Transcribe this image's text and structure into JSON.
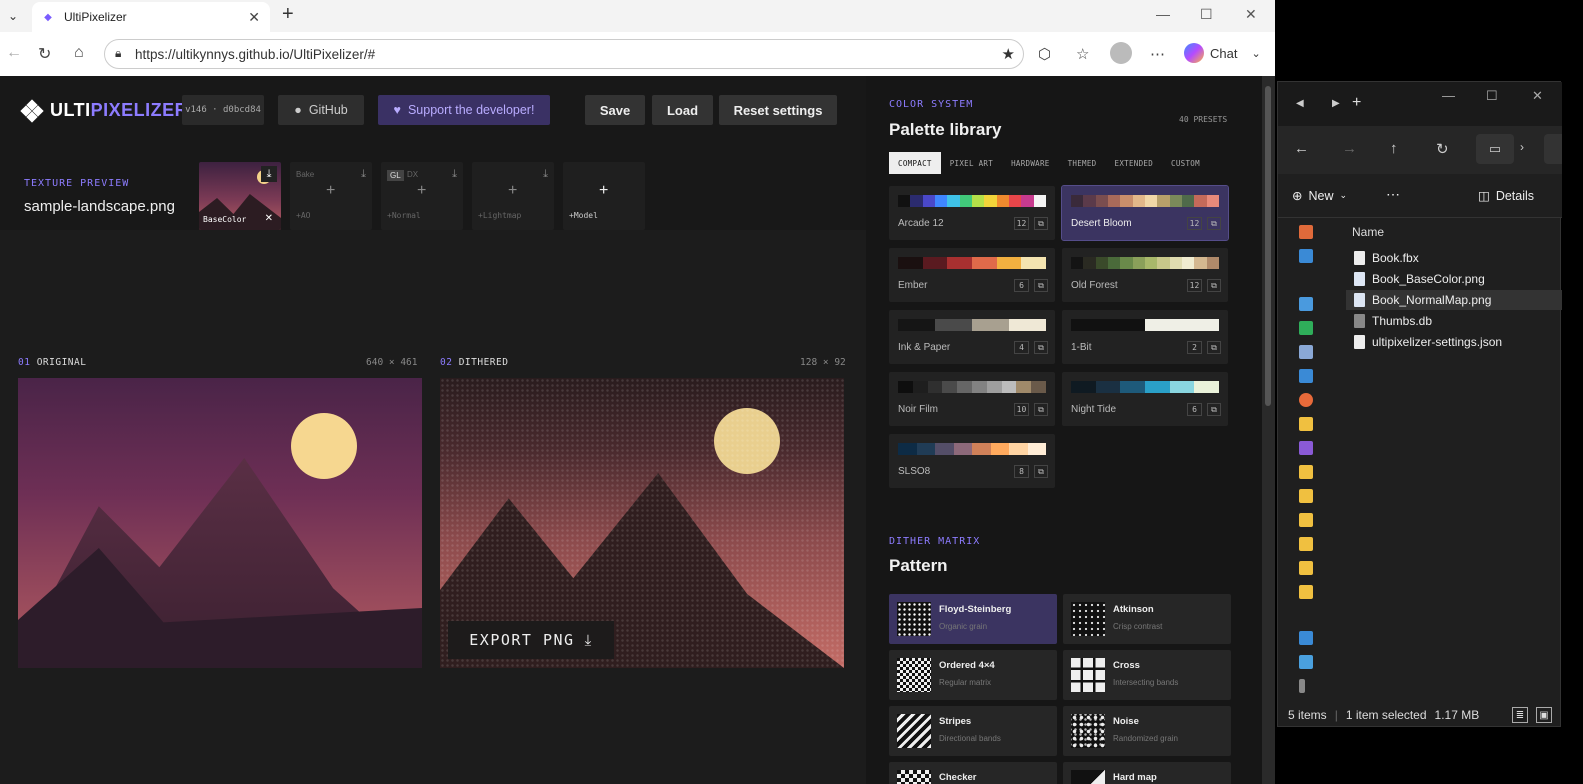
{
  "browser": {
    "tab_title": "UltiPixelizer",
    "url": "https://ultikynnys.github.io/UltiPixelizer/#",
    "chat_label": "Chat"
  },
  "app": {
    "logo_prefix": "ULTI",
    "logo_suffix": "PIXELIZER",
    "version": "v146 · d0bcd84",
    "github_label": "GitHub",
    "support_label": "Support the developer!",
    "save_label": "Save",
    "load_label": "Load",
    "reset_label": "Reset settings",
    "texture_preview_label": "TEXTURE PREVIEW",
    "texture_file": "sample-landscape.png",
    "slots": {
      "basecolor": "BaseColor",
      "bake": "Bake",
      "gl": "GL",
      "dx": "DX",
      "ao": "+AO",
      "normal": "+Normal",
      "lightmap": "+Lightmap",
      "model": "+Model"
    },
    "panels": {
      "original_num": "01",
      "original_label": "ORIGINAL",
      "original_dim": "640 × 461",
      "dithered_num": "02",
      "dithered_label": "DITHERED",
      "dithered_dim": "128 × 92"
    },
    "export_label": "EXPORT PNG"
  },
  "palette": {
    "section_label": "COLOR SYSTEM",
    "title": "Palette library",
    "preset_count": "40 PRESETS",
    "tabs": [
      "COMPACT",
      "PIXEL ART",
      "HARDWARE",
      "THEMED",
      "EXTENDED",
      "CUSTOM"
    ],
    "cards": [
      {
        "name": "Arcade 12",
        "count": "12",
        "colors": [
          "#111",
          "#2b2b6e",
          "#4a48c9",
          "#3f86ff",
          "#3fc2e8",
          "#41c97a",
          "#b4e049",
          "#f2d43a",
          "#f08a2e",
          "#e8464a",
          "#c73a8e",
          "#f4f4f4"
        ]
      },
      {
        "name": "Desert Bloom",
        "count": "12",
        "colors": [
          "#3a2a3a",
          "#5b3a4a",
          "#7a4d4f",
          "#a86a5a",
          "#c98e6b",
          "#e2b789",
          "#f1d7a7",
          "#b8a06a",
          "#7a8a5a",
          "#4f6a4a",
          "#c46a5a",
          "#e88a7a"
        ]
      },
      {
        "name": "Ember",
        "count": "6",
        "colors": [
          "#1a1010",
          "#5a1a20",
          "#a83030",
          "#e06a4a",
          "#f2b040",
          "#f4e4b0"
        ]
      },
      {
        "name": "Old Forest",
        "count": "12",
        "colors": [
          "#141414",
          "#2a2a22",
          "#3a4a2a",
          "#4a6a3a",
          "#6a8a4a",
          "#8aa05a",
          "#a8b86a",
          "#c8c88a",
          "#e0dcb0",
          "#f0ecd0",
          "#d4b890",
          "#b08a6a"
        ]
      },
      {
        "name": "Ink & Paper",
        "count": "4",
        "colors": [
          "#151515",
          "#4a4a4a",
          "#a8a090",
          "#efe8d6"
        ]
      },
      {
        "name": "1-Bit",
        "count": "2",
        "colors": [
          "#111111",
          "#efefe6"
        ]
      },
      {
        "name": "Noir Film",
        "count": "10",
        "colors": [
          "#0e0e0e",
          "#1e1e1e",
          "#2f2f2f",
          "#4a4a4a",
          "#666",
          "#828282",
          "#9e9e9e",
          "#bcbcbc",
          "#a08a6a",
          "#6a5a4a"
        ]
      },
      {
        "name": "Night Tide",
        "count": "6",
        "colors": [
          "#0f1a22",
          "#1a3042",
          "#1e5a7a",
          "#2aa0c8",
          "#8ad6e0",
          "#eaf2da"
        ]
      },
      {
        "name": "SLSO8",
        "count": "8",
        "colors": [
          "#0d2b45",
          "#203c56",
          "#544e68",
          "#8d697a",
          "#d08159",
          "#ffaa5e",
          "#ffd4a3",
          "#ffecd6"
        ]
      }
    ]
  },
  "dither": {
    "section_label": "DITHER MATRIX",
    "title": "Pattern",
    "patterns": [
      {
        "name": "Floyd-Steinberg",
        "desc": "Organic grain"
      },
      {
        "name": "Atkinson",
        "desc": "Crisp contrast"
      },
      {
        "name": "Ordered 4×4",
        "desc": "Regular matrix"
      },
      {
        "name": "Cross",
        "desc": "Intersecting bands"
      },
      {
        "name": "Stripes",
        "desc": "Directional bands"
      },
      {
        "name": "Noise",
        "desc": "Randomized grain"
      },
      {
        "name": "Checker",
        "desc": ""
      },
      {
        "name": "Hard map",
        "desc": ""
      }
    ]
  },
  "explorer": {
    "new_label": "New",
    "details_label": "Details",
    "column_name": "Name",
    "files": [
      "Book.fbx",
      "Book_BaseColor.png",
      "Book_NormalMap.png",
      "Thumbs.db",
      "ultipixelizer-settings.json"
    ],
    "status_items": "5 items",
    "status_selected": "1 item selected",
    "status_size": "1.17 MB"
  }
}
